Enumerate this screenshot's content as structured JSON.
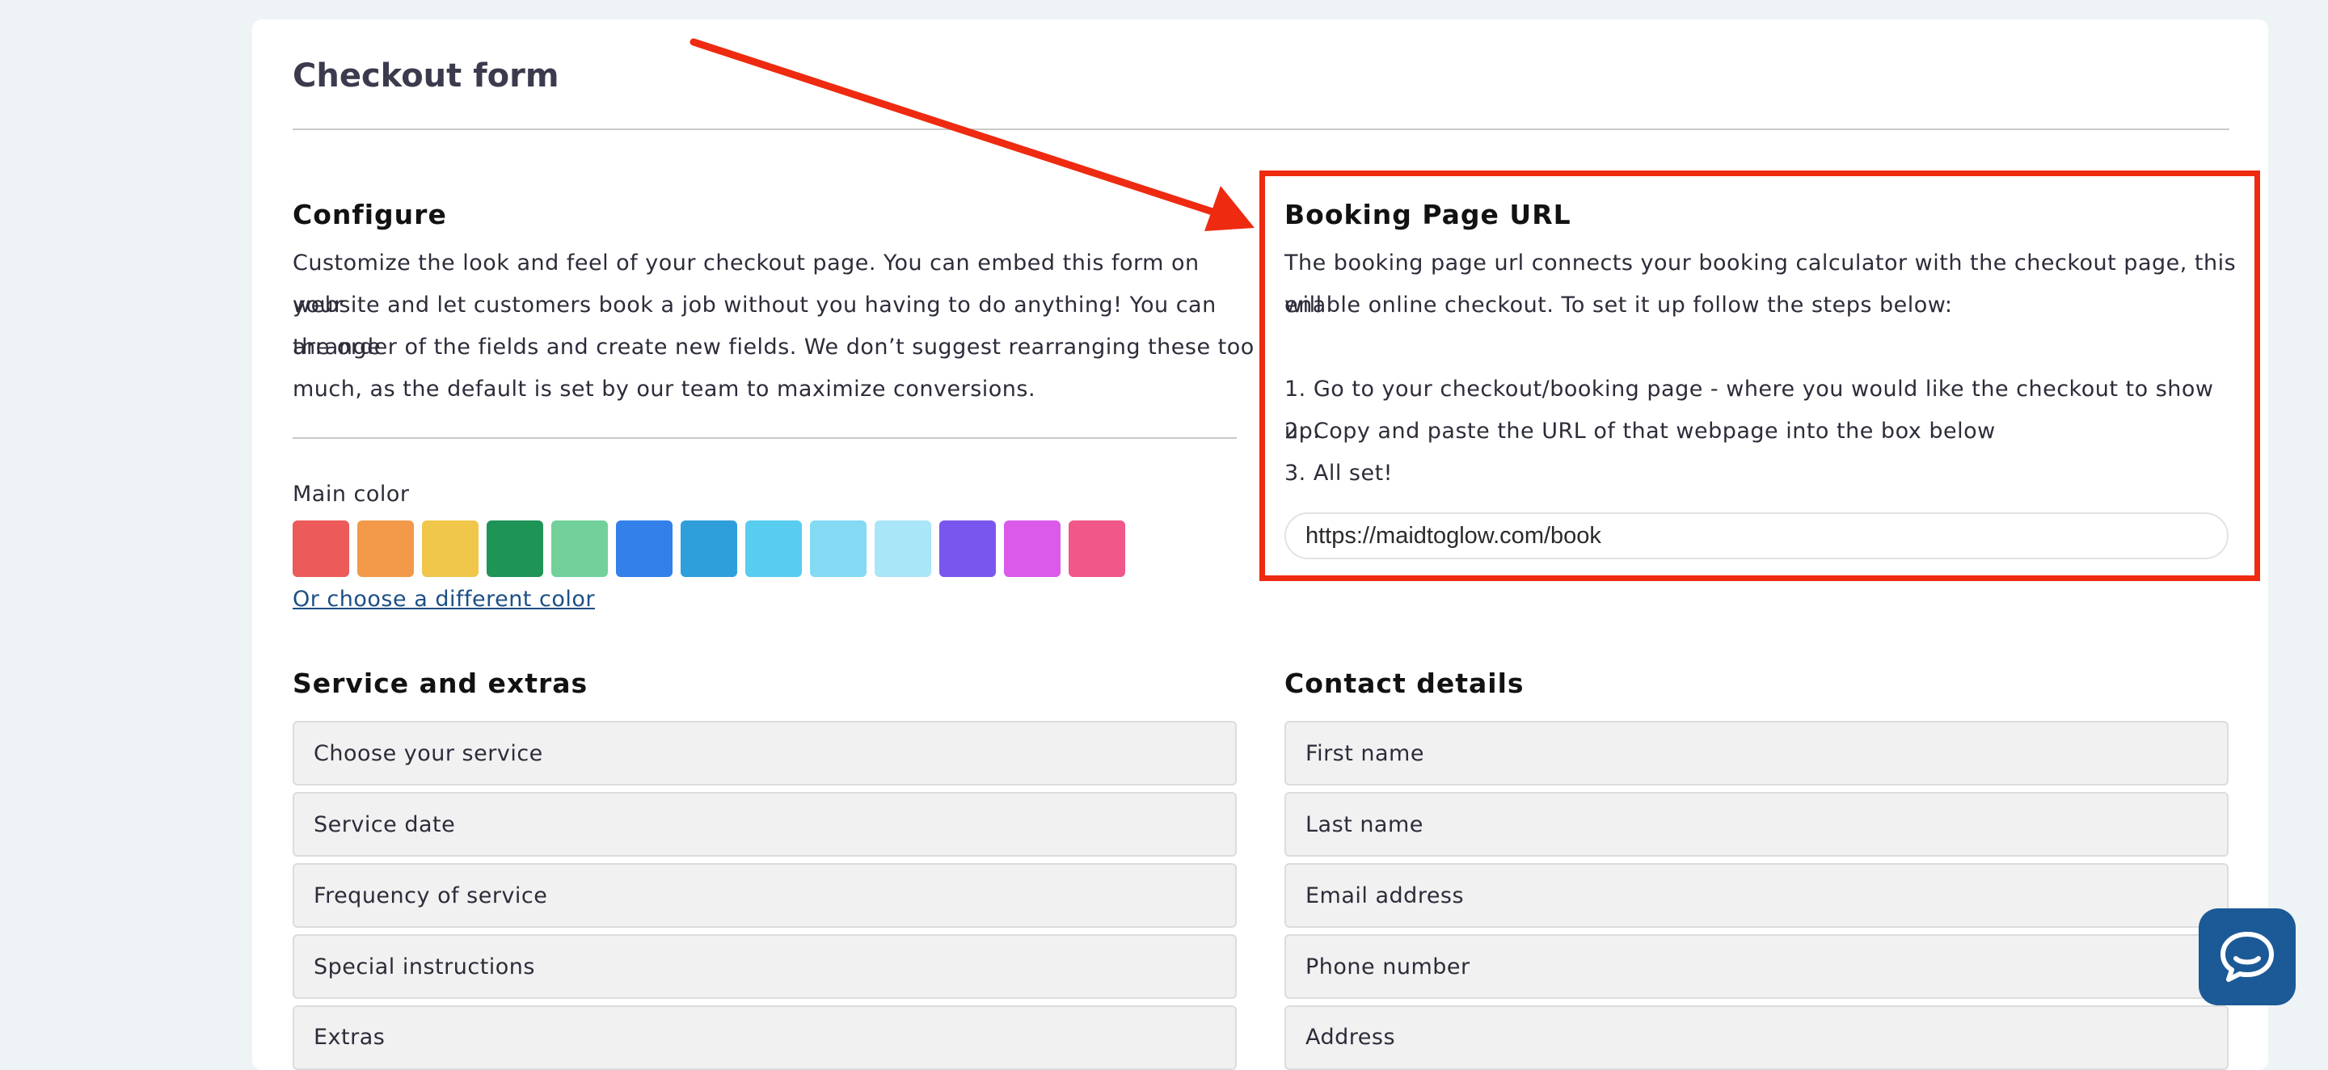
{
  "page": {
    "title": "Checkout form"
  },
  "configure": {
    "heading": "Configure",
    "lines": [
      "Customize the look and feel of your checkout page. You can embed this form on your",
      "website and let customers book a job without you having to do anything! You can arrange",
      "the order of the fields and create new fields. We don’t suggest rearranging these too",
      "much, as the default is set by our team to maximize conversions."
    ],
    "main_color_label": "Main color",
    "swatches": [
      "#ec5a5a",
      "#f29a4a",
      "#f0c74a",
      "#1f9457",
      "#72d19a",
      "#3380ea",
      "#2f9fdc",
      "#58cdf0",
      "#84d9f3",
      "#a9e6f7",
      "#7957ee",
      "#db5aea",
      "#ef5889"
    ],
    "different_color_link": "Or choose a different color"
  },
  "booking": {
    "heading": "Booking Page URL",
    "lines": [
      "The booking page url connects your booking calculator with the checkout page, this will",
      "enable online checkout. To set it up follow the steps below:",
      "",
      "1. Go to your checkout/booking page - where you would like the checkout to show up.",
      "2. Copy and paste the URL of that webpage into the box below",
      "3. All set!"
    ],
    "url_value": "https://maidtoglow.com/book",
    "highlight_color": "#ee2a10"
  },
  "service": {
    "heading": "Service and extras",
    "fields": [
      "Choose your service",
      "Service date",
      "Frequency of service",
      "Special instructions",
      "Extras"
    ]
  },
  "contact": {
    "heading": "Contact details",
    "fields": [
      "First name",
      "Last name",
      "Email address",
      "Phone number",
      "Address"
    ]
  },
  "chat": {
    "icon": "chat-bubble-icon",
    "color": "#1b5a96"
  }
}
